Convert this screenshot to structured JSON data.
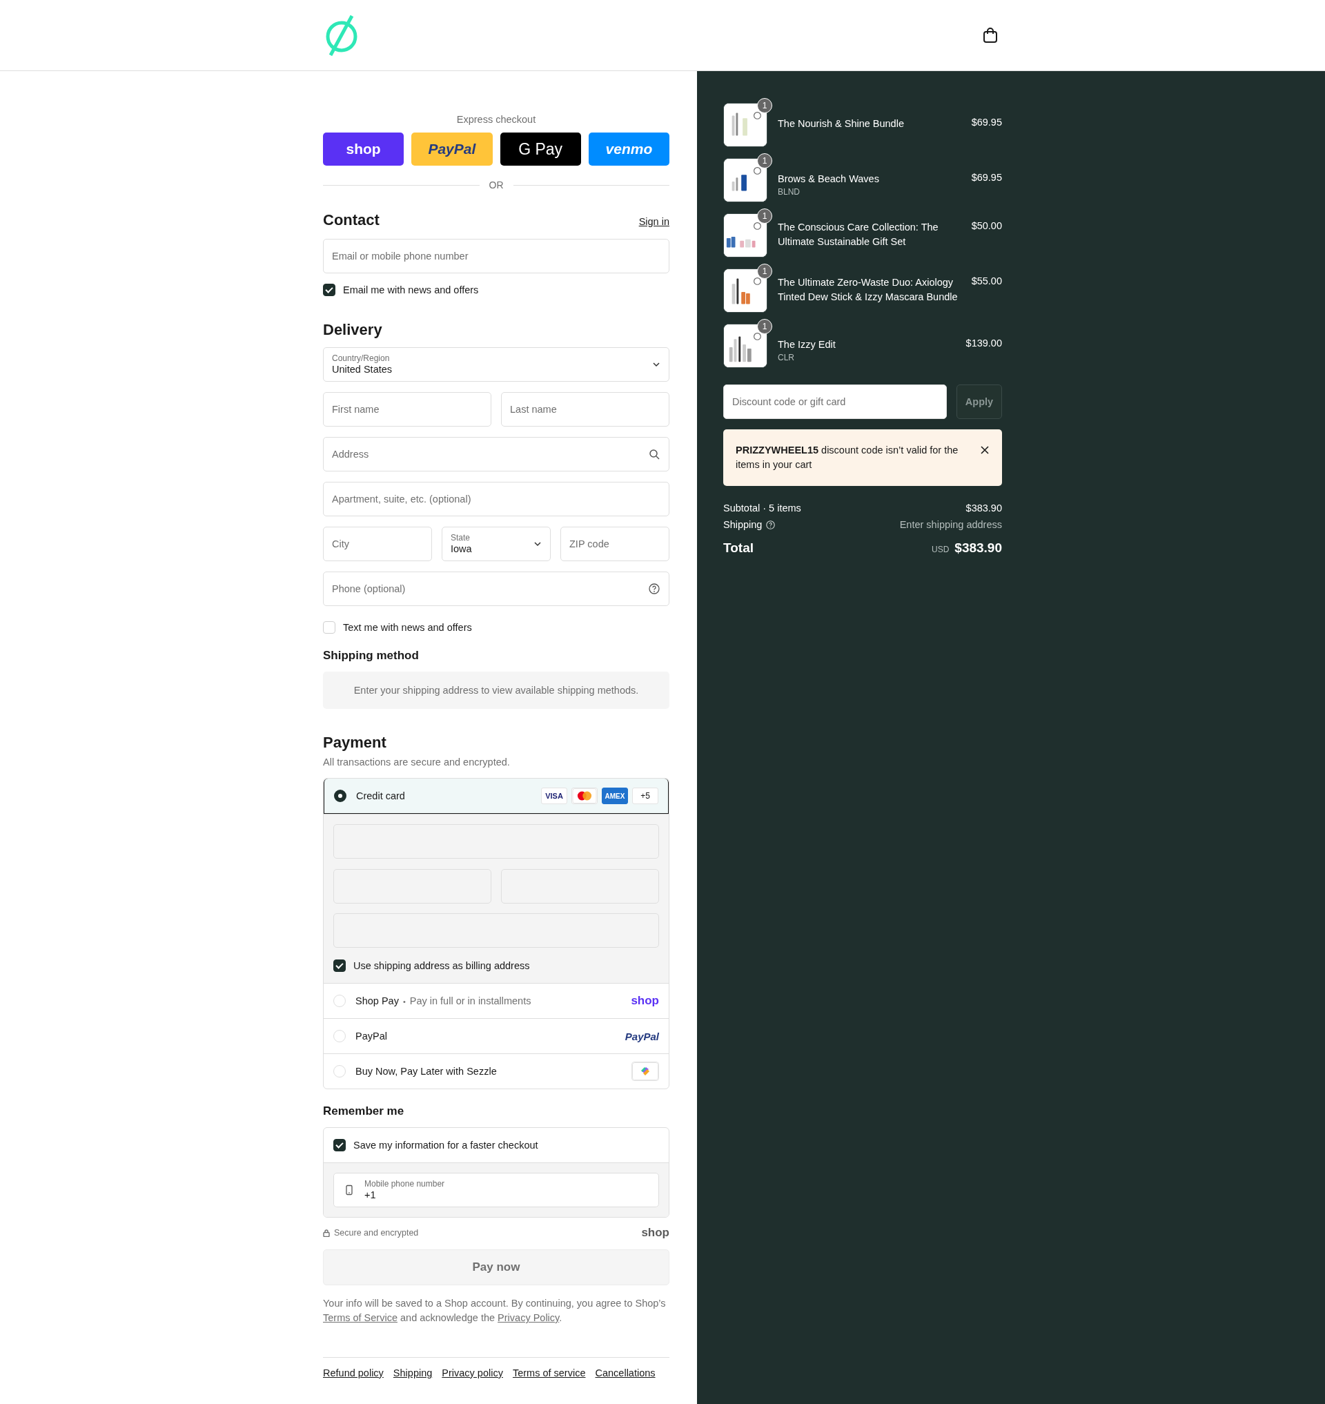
{
  "express_checkout": {
    "label": "Express checkout",
    "buttons": [
      {
        "kind": "shop",
        "label": "shop"
      },
      {
        "kind": "paypal",
        "label": "PayPal"
      },
      {
        "kind": "gpay",
        "label": "G Pay"
      },
      {
        "kind": "venmo",
        "label": "venmo"
      }
    ],
    "divider": "OR"
  },
  "contact": {
    "title": "Contact",
    "sign_in": "Sign in",
    "email": {
      "placeholder": "Email or mobile phone number"
    },
    "newsletter": {
      "label": "Email me with news and offers",
      "checked": true
    }
  },
  "delivery": {
    "title": "Delivery",
    "rows": [
      [
        {
          "kind": "select",
          "label": "Country/Region",
          "value": "United States"
        }
      ],
      [
        {
          "kind": "text",
          "placeholder": "First name"
        },
        {
          "kind": "text",
          "placeholder": "Last name"
        }
      ],
      [
        {
          "kind": "search",
          "placeholder": "Address"
        }
      ],
      [
        {
          "kind": "text",
          "placeholder": "Apartment, suite, etc. (optional)"
        }
      ],
      [
        {
          "kind": "text",
          "placeholder": "City"
        },
        {
          "kind": "select",
          "label": "State",
          "value": "Iowa"
        },
        {
          "kind": "text",
          "placeholder": "ZIP code"
        }
      ],
      [
        {
          "kind": "help",
          "placeholder": "Phone (optional)"
        }
      ]
    ],
    "sms": {
      "label": "Text me with news and offers",
      "checked": false
    }
  },
  "shipping_method": {
    "title": "Shipping method",
    "message": "Enter your shipping address to view available shipping methods."
  },
  "payment": {
    "title": "Payment",
    "subtitle": "All transactions are secure and encrypted.",
    "methods": [
      {
        "kind": "card",
        "label": "Credit card",
        "selected": true,
        "brands": [
          {
            "kind": "visa",
            "label": "VISA"
          },
          {
            "kind": "mastercard"
          },
          {
            "kind": "amex",
            "label": "AMEX"
          },
          {
            "kind": "more",
            "label": "+5"
          }
        ],
        "billing": {
          "label": "Use shipping address as billing address",
          "checked": true
        }
      },
      {
        "kind": "shop_pay",
        "label": "Shop Pay",
        "separator": "•",
        "note": "Pay in full or in installments",
        "logo": "shop",
        "selected": false
      },
      {
        "kind": "paypal",
        "label": "PayPal",
        "logo": "PayPal",
        "selected": false
      },
      {
        "kind": "sezzle",
        "label": "Buy Now, Pay Later with Sezzle",
        "selected": false
      }
    ]
  },
  "remember_me": {
    "title": "Remember me",
    "save": {
      "label": "Save my information for a faster checkout",
      "checked": true
    },
    "phone": {
      "label": "Mobile phone number",
      "value": "+1"
    }
  },
  "secure_note": "Secure and encrypted",
  "shop_logo": "shop",
  "pay_button": {
    "label": "Pay now",
    "disabled": true
  },
  "legal": [
    {
      "text": "Your info will be saved to a Shop account. By continuing, you agree to Shop’s "
    },
    {
      "text": "Terms of Service",
      "link": true
    },
    {
      "text": " and acknowledge the "
    },
    {
      "text": "Privacy Policy",
      "link": true
    },
    {
      "text": "."
    }
  ],
  "footer_links": [
    "Refund policy",
    "Shipping",
    "Privacy policy",
    "Terms of service",
    "Cancellations"
  ],
  "order_summary": {
    "items": [
      {
        "title": "The Nourish & Shine Bundle",
        "price": "$69.95",
        "quantity": "1"
      },
      {
        "title": "Brows & Beach Waves",
        "variant": "BLND",
        "price": "$69.95",
        "quantity": "1"
      },
      {
        "title": "The Conscious Care Collection: The Ultimate Sustainable Gift Set",
        "price": "$50.00",
        "quantity": "1"
      },
      {
        "title": "The Ultimate Zero-Waste Duo: Axiology Tinted Dew Stick & Izzy Mascara Bundle",
        "price": "$55.00",
        "quantity": "1"
      },
      {
        "title": "The Izzy Edit",
        "variant": "CLR",
        "price": "$139.00",
        "quantity": "1"
      }
    ],
    "discount": {
      "placeholder": "Discount code or gift card",
      "button": "Apply"
    },
    "alert": "**PRIZZYWHEEL15** discount code isn’t valid for the items in your cart",
    "subtotal": {
      "label": "Subtotal · 5 items",
      "value": "$383.90"
    },
    "shipping": {
      "label": "Shipping",
      "value": "Enter shipping address"
    },
    "total": {
      "label": "Total",
      "currency": "USD",
      "value": "$383.90"
    }
  }
}
